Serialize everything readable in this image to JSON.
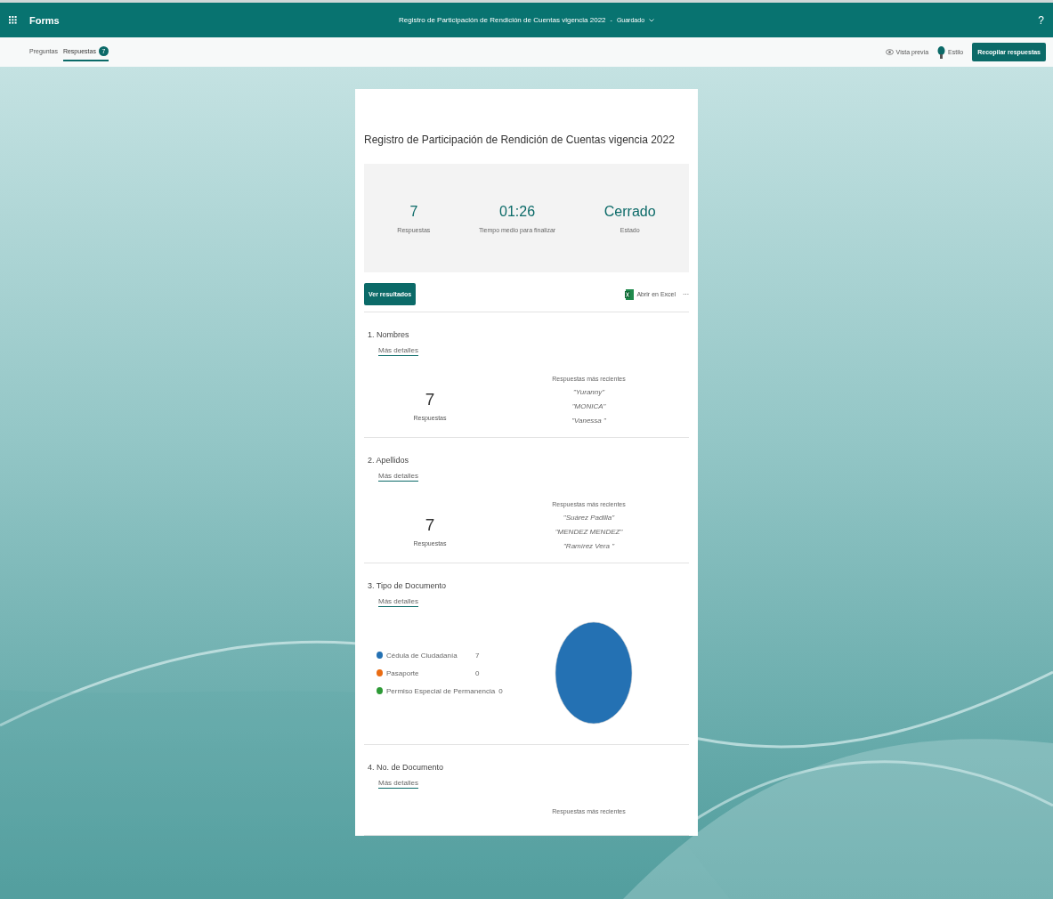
{
  "app_bar": {
    "app_name": "Forms",
    "form_title": "Registro de Participación de Rendición de Cuentas vigencia 2022",
    "separator": "-",
    "save_status": "Guardado",
    "help": "?"
  },
  "tabs": [
    {
      "label": "Preguntas",
      "selected": false
    },
    {
      "label": "Respuestas",
      "selected": true,
      "badge": "7"
    }
  ],
  "toolbar": {
    "preview": "Vista previa",
    "style": "Estilo",
    "collect": "Recopilar respuestas"
  },
  "form": {
    "title": "Registro de Participación de Rendición de Cuentas vigencia 2022",
    "stats": [
      {
        "value": "7",
        "label": "Respuestas"
      },
      {
        "value": "01:26",
        "label": "Tiempo medio para finalizar"
      },
      {
        "value": "Cerrado",
        "label": "Estado"
      }
    ],
    "view_results": "Ver resultados",
    "open_excel": "Abrir en Excel",
    "more": "···",
    "questions": [
      {
        "kind": "text",
        "title": "1. Nombres",
        "details": "Más detalles",
        "count": "7",
        "count_label": "Respuestas",
        "recent_title": "Respuestas más recientes",
        "recent": [
          "\"Yuranny\"",
          "\"MONICA\"",
          "\"Vanessa \""
        ]
      },
      {
        "kind": "text",
        "title": "2. Apellidos",
        "details": "Más detalles",
        "count": "7",
        "count_label": "Respuestas",
        "recent_title": "Respuestas más recientes",
        "recent": [
          "\"Suárez Padilla\"",
          "\"MENDEZ MENDEZ\"",
          "\"Ramírez Vera \""
        ]
      },
      {
        "kind": "choice",
        "title": "3. Tipo de Documento",
        "details": "Más detalles",
        "options": [
          {
            "count": "7",
            "color": "#2471b3"
          },
          {
            "count": "0",
            "color": "#ea6c13"
          },
          {
            "count": "0",
            "color": "#2d9a36"
          }
        ],
        "chart_data": {
          "type": "pie",
          "categories": [
            "Cédula de Ciudadanía",
            "Pasaporte",
            "Permiso Especial de Permanencia"
          ],
          "values": [
            100,
            0,
            0
          ]
        }
      },
      {
        "kind": "text",
        "title": "4. No. de Documento",
        "details": "Más detalles",
        "recent_title": "Respuestas más recientes"
      }
    ]
  }
}
